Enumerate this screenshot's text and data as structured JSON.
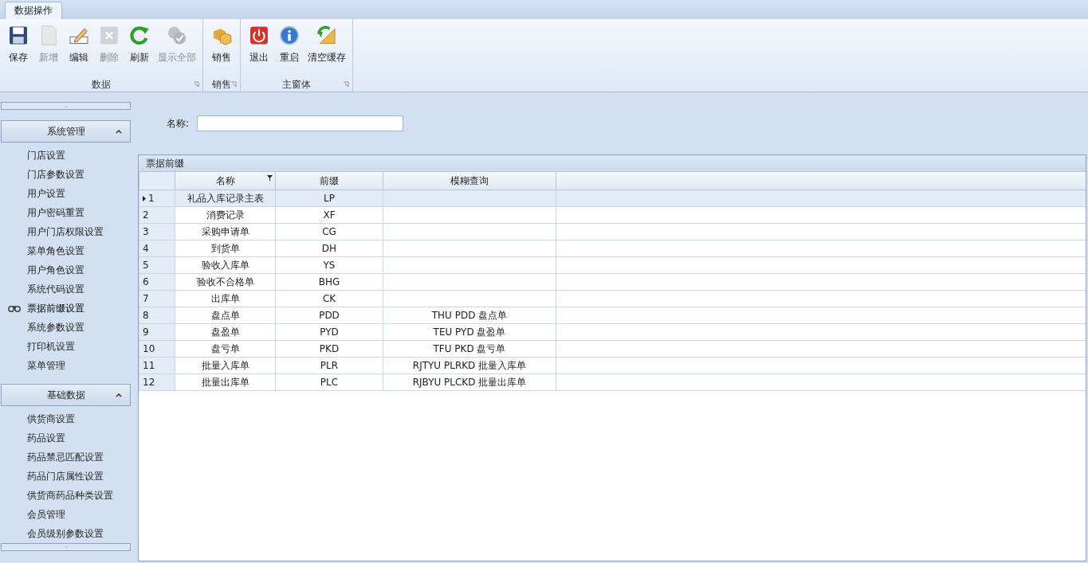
{
  "ribbon": {
    "tabs": [
      {
        "label": "数据操作",
        "selected": true
      }
    ],
    "groups": [
      {
        "label": "数据",
        "buttons": [
          {
            "kind": "save",
            "label": "保存",
            "disabled": false
          },
          {
            "kind": "new",
            "label": "新增",
            "disabled": true
          },
          {
            "kind": "edit",
            "label": "编辑",
            "disabled": false
          },
          {
            "kind": "delete",
            "label": "删除",
            "disabled": true
          },
          {
            "kind": "refresh",
            "label": "刷新",
            "disabled": false
          },
          {
            "kind": "showall",
            "label": "显示全部",
            "disabled": true
          }
        ]
      },
      {
        "label": "销售",
        "buttons": [
          {
            "kind": "boxes",
            "label": "销售",
            "disabled": false
          }
        ]
      },
      {
        "label": "主窗体",
        "buttons": [
          {
            "kind": "power",
            "label": "退出",
            "disabled": false
          },
          {
            "kind": "info",
            "label": "重启",
            "disabled": false
          },
          {
            "kind": "clear",
            "label": "清空缓存",
            "disabled": false
          }
        ]
      }
    ]
  },
  "sidebar": {
    "groups": [
      {
        "title": "系统管理",
        "expanded": true,
        "items": [
          {
            "label": "门店设置",
            "selected": false
          },
          {
            "label": "门店参数设置",
            "selected": false
          },
          {
            "label": "用户设置",
            "selected": false
          },
          {
            "label": "用户密码重置",
            "selected": false
          },
          {
            "label": "用户门店权限设置",
            "selected": false
          },
          {
            "label": "菜单角色设置",
            "selected": false
          },
          {
            "label": "用户角色设置",
            "selected": false
          },
          {
            "label": "系统代码设置",
            "selected": false
          },
          {
            "label": "票据前缀设置",
            "selected": true
          },
          {
            "label": "系统参数设置",
            "selected": false
          },
          {
            "label": "打印机设置",
            "selected": false
          },
          {
            "label": "菜单管理",
            "selected": false
          }
        ]
      },
      {
        "title": "基础数据",
        "expanded": true,
        "items": [
          {
            "label": "供货商设置",
            "selected": false
          },
          {
            "label": "药品设置",
            "selected": false
          },
          {
            "label": "药品禁忌匹配设置",
            "selected": false
          },
          {
            "label": "药品门店属性设置",
            "selected": false
          },
          {
            "label": "供货商药品种类设置",
            "selected": false
          },
          {
            "label": "会员管理",
            "selected": false
          },
          {
            "label": "会员级别参数设置",
            "selected": false
          }
        ]
      }
    ]
  },
  "filter": {
    "label": "名称:"
  },
  "table": {
    "title": "票据前缀",
    "columns": [
      {
        "label": "名称",
        "filter": true
      },
      {
        "label": "前缀",
        "filter": false
      },
      {
        "label": "模糊查询",
        "filter": false
      }
    ],
    "rows": [
      {
        "num": "1",
        "selected": true,
        "cells": [
          "礼品入库记录主表",
          "LP",
          ""
        ]
      },
      {
        "num": "2",
        "selected": false,
        "cells": [
          "消费记录",
          "XF",
          ""
        ]
      },
      {
        "num": "3",
        "selected": false,
        "cells": [
          "采购申请单",
          "CG",
          ""
        ]
      },
      {
        "num": "4",
        "selected": false,
        "cells": [
          "到货单",
          "DH",
          ""
        ]
      },
      {
        "num": "5",
        "selected": false,
        "cells": [
          "验收入库单",
          "YS",
          ""
        ]
      },
      {
        "num": "6",
        "selected": false,
        "cells": [
          "验收不合格单",
          "BHG",
          ""
        ]
      },
      {
        "num": "7",
        "selected": false,
        "cells": [
          "出库单",
          "CK",
          ""
        ]
      },
      {
        "num": "8",
        "selected": false,
        "cells": [
          "盘点单",
          "PDD",
          "THU PDD 盘点单"
        ]
      },
      {
        "num": "9",
        "selected": false,
        "cells": [
          "盘盈单",
          "PYD",
          "TEU PYD 盘盈单"
        ]
      },
      {
        "num": "10",
        "selected": false,
        "cells": [
          "盘亏单",
          "PKD",
          "TFU PKD 盘亏单"
        ]
      },
      {
        "num": "11",
        "selected": false,
        "cells": [
          "批量入库单",
          "PLR",
          "RJTYU PLRKD 批量入库单"
        ]
      },
      {
        "num": "12",
        "selected": false,
        "cells": [
          "批量出库单",
          "PLC",
          "RJBYU PLCKD 批量出库单"
        ]
      }
    ]
  }
}
